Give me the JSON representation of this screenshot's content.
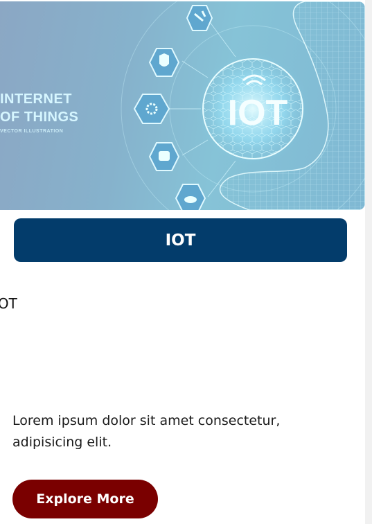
{
  "hero": {
    "line1": "INTERNET",
    "line2": "OF THINGS",
    "line3": "VECTOR ILLUSTRATION",
    "globe_label": "IOT"
  },
  "card": {
    "banner_title": "IOT",
    "subtitle": "IOT",
    "description": "Lorem ipsum dolor sit amet consectetur, adipisicing elit.",
    "button_label": "Explore More"
  },
  "colors": {
    "banner": "#033c6b",
    "button": "#7a0000",
    "hero_glow": "#bff4ff"
  },
  "icons": [
    "robot-arm-icon",
    "shield-check-icon",
    "gear-icon",
    "database-icon",
    "cloud-icon",
    "wifi-icon",
    "globe-icon",
    "wireframe-hand-icon"
  ]
}
